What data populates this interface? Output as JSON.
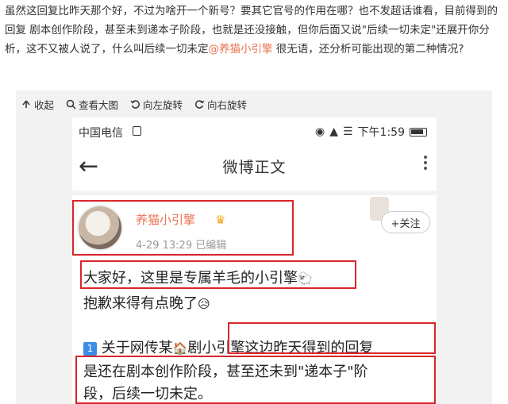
{
  "post": {
    "text_before": "虽然这回复比昨天那个好，不过为啥开一个新号？要其它官号的作用在哪？也不发超话谁看，目前得到的回复 剧本创作阶段，甚至未到递本子阶段，也就是还没接触，但你后面又说\"后续一切未定\"还展开你分析，这不又被人说了，什么叫后续一切未定",
    "mention": "@养猫小引擎",
    "text_after": " 很无语，还分析可能出现的第二种情况?"
  },
  "toolbar": {
    "collapse": "收起",
    "view_large": "查看大图",
    "rotate_left": "向左旋转",
    "rotate_right": "向右旋转"
  },
  "phone": {
    "carrier": "中国电信",
    "status_right": "下午1:59",
    "nav_title": "微博正文",
    "username": "养猫小引擎",
    "meta": "4-29 13:29  已编辑",
    "follow": "+关注",
    "line1": "大家好，这里是专属羊毛的小引擎",
    "line2": "抱歉来得有点晚了",
    "line3_num": "1",
    "line3": "关于网传某",
    "line3_b": "剧小引擎这边昨天得到的回复",
    "line4": "是还在剧本创作阶段，甚至还未到\"递本子\"阶",
    "line5": "段，后续一切未定。"
  },
  "colors": {
    "mention": "#eb7350",
    "highlight_box": "#d9262b",
    "toolbar_bg": "#f2f2f2"
  }
}
